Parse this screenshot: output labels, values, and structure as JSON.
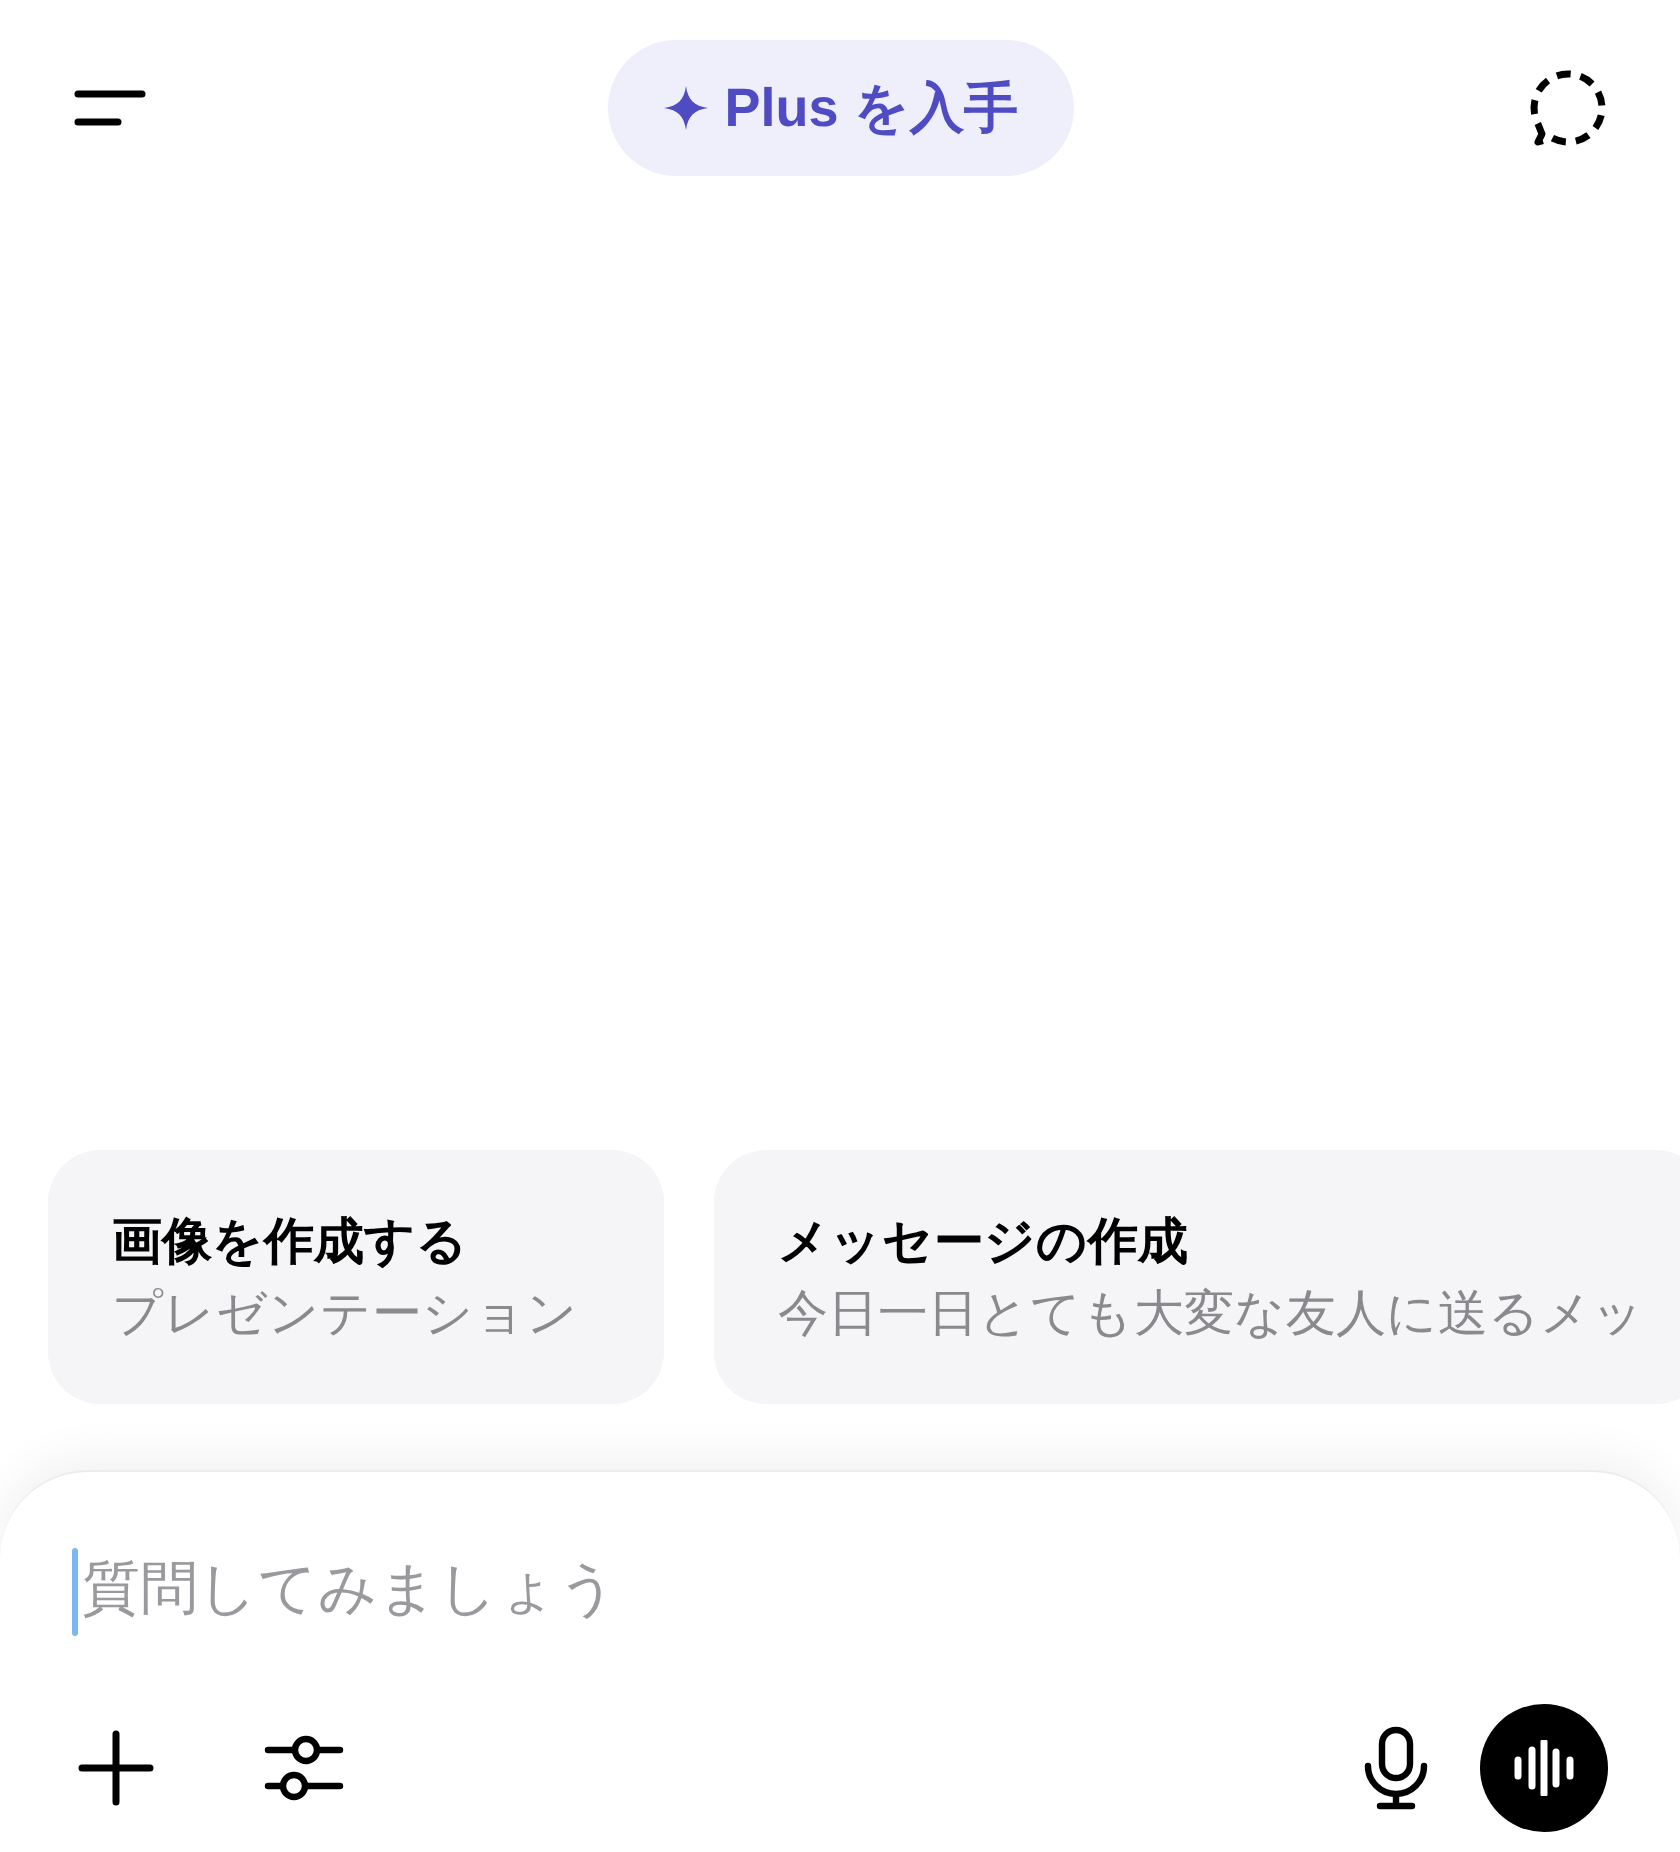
{
  "header": {
    "upgrade_button": {
      "label": "Plus を入手"
    }
  },
  "suggestions": [
    {
      "title": "画像を作成する",
      "subtitle": "プレゼンテーション"
    },
    {
      "title": "メッセージの作成",
      "subtitle": "今日一日とても大変な友人に送るメッ"
    }
  ],
  "composer": {
    "placeholder": "質問してみましょう"
  }
}
